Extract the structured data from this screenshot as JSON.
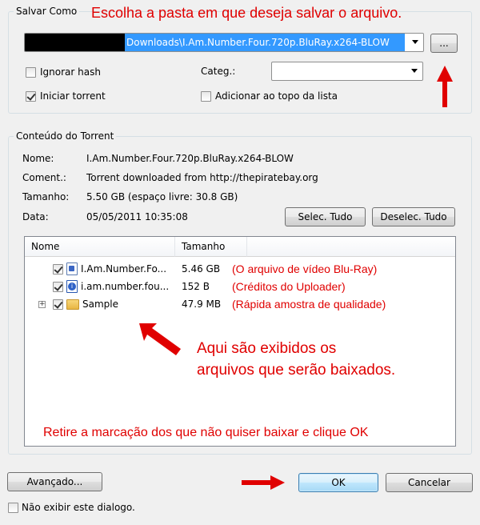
{
  "save_as": {
    "legend": "Salvar Como",
    "path_value": "Downloads\\I.Am.Number.Four.720p.BluRay.x264-BLOW",
    "browse_label": "...",
    "ignore_hash_label": "Ignorar hash",
    "ignore_hash_checked": false,
    "category_label": "Categ.:",
    "category_value": "",
    "start_torrent_label": "Iniciar torrent",
    "start_torrent_checked": true,
    "add_top_label": "Adicionar ao topo da lista",
    "add_top_checked": false
  },
  "torrent": {
    "legend": "Conteúdo do Torrent",
    "name_label": "Nome:",
    "name_value": "I.Am.Number.Four.720p.BluRay.x264-BLOW",
    "comment_label": "Coment.:",
    "comment_value": "Torrent downloaded from http://thepiratebay.org",
    "size_label": "Tamanho:",
    "size_value": "5.50 GB (espaço livre: 30.8 GB)",
    "date_label": "Data:",
    "date_value": "05/05/2011 10:35:08",
    "select_all_label": "Selec. Tudo",
    "deselect_all_label": "Deselec. Tudo"
  },
  "file_list": {
    "columns": {
      "name": "Nome",
      "size": "Tamanho"
    },
    "rows": [
      {
        "name": "I.Am.Number.Fo...",
        "size": "5.46 GB",
        "checked": true,
        "note": "(O arquivo de vídeo Blu-Ray)"
      },
      {
        "name": "i.am.number.fou...",
        "size": "152 B",
        "checked": true,
        "note": "(Créditos do Uploader)"
      },
      {
        "name": "Sample",
        "size": "47.9 MB",
        "checked": true,
        "note": "(Rápida amostra de qualidade)"
      }
    ]
  },
  "annotations": {
    "top": "Escolha a pasta em que deseja salvar o arquivo.",
    "middle_line1": "Aqui são exibidos os",
    "middle_line2": "arquivos que serão baixados.",
    "bottom": "Retire a marcação dos que não quiser baixar e clique OK"
  },
  "footer": {
    "advanced_label": "Avançado...",
    "ok_label": "OK",
    "cancel_label": "Cancelar",
    "dont_show_label": "Não exibir este dialogo.",
    "dont_show_checked": false
  },
  "colors": {
    "annotation_red": "#e00000",
    "selection_blue": "#3399ff",
    "background": "#f0f0f0"
  }
}
